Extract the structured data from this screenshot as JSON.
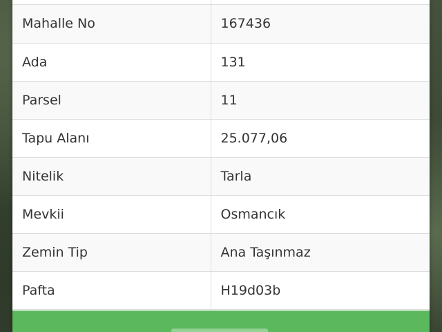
{
  "parcel_info": {
    "rows": [
      {
        "label": "Mahalle No",
        "value": "167436"
      },
      {
        "label": "Ada",
        "value": "131"
      },
      {
        "label": "Parsel",
        "value": "11"
      },
      {
        "label": "Tapu Alanı",
        "value": "25.077,06"
      },
      {
        "label": "Nitelik",
        "value": "Tarla"
      },
      {
        "label": "Mevkii",
        "value": "Osmancık"
      },
      {
        "label": "Zemin Tip",
        "value": "Ana Taşınmaz"
      },
      {
        "label": "Pafta",
        "value": "H19d03b"
      }
    ]
  },
  "colors": {
    "button_green": "#5cb85c",
    "row_stripe": "#f9f9f9",
    "border": "#dddddd",
    "text": "#333333"
  }
}
